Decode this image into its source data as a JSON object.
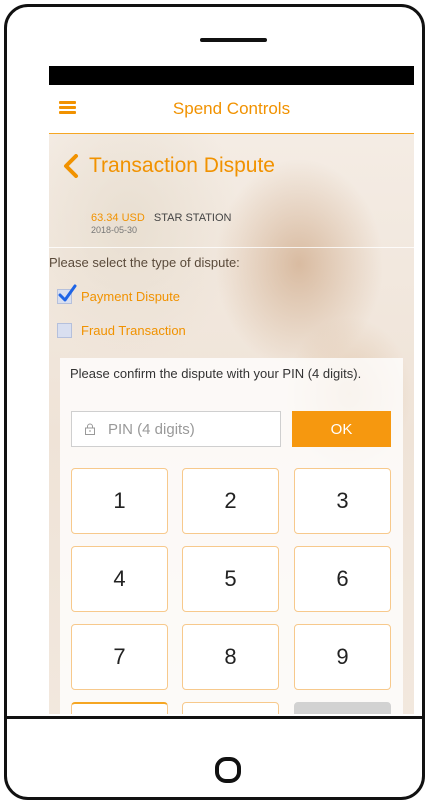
{
  "header": {
    "title": "Spend Controls"
  },
  "page": {
    "title": "Transaction Dispute"
  },
  "transaction": {
    "amount": "63.34 USD",
    "merchant": "STAR STATION",
    "date": "2018-05-30"
  },
  "dispute": {
    "prompt": "Please select the type of dispute:",
    "options": [
      {
        "label": "Payment Dispute",
        "checked": true
      },
      {
        "label": "Fraud Transaction",
        "checked": false
      }
    ]
  },
  "pin": {
    "prompt": "Please confirm the dispute with your PIN (4 digits).",
    "placeholder": "PIN (4 digits)",
    "ok_label": "OK"
  },
  "keypad": {
    "keys": [
      "1",
      "2",
      "3",
      "4",
      "5",
      "6",
      "7",
      "8",
      "9"
    ]
  },
  "colors": {
    "accent": "#f19200",
    "button": "#f6980f"
  },
  "icons": {
    "menu": "menu-icon",
    "back": "chevron-left-icon",
    "lock": "lock-icon",
    "home": "home-button-icon"
  }
}
